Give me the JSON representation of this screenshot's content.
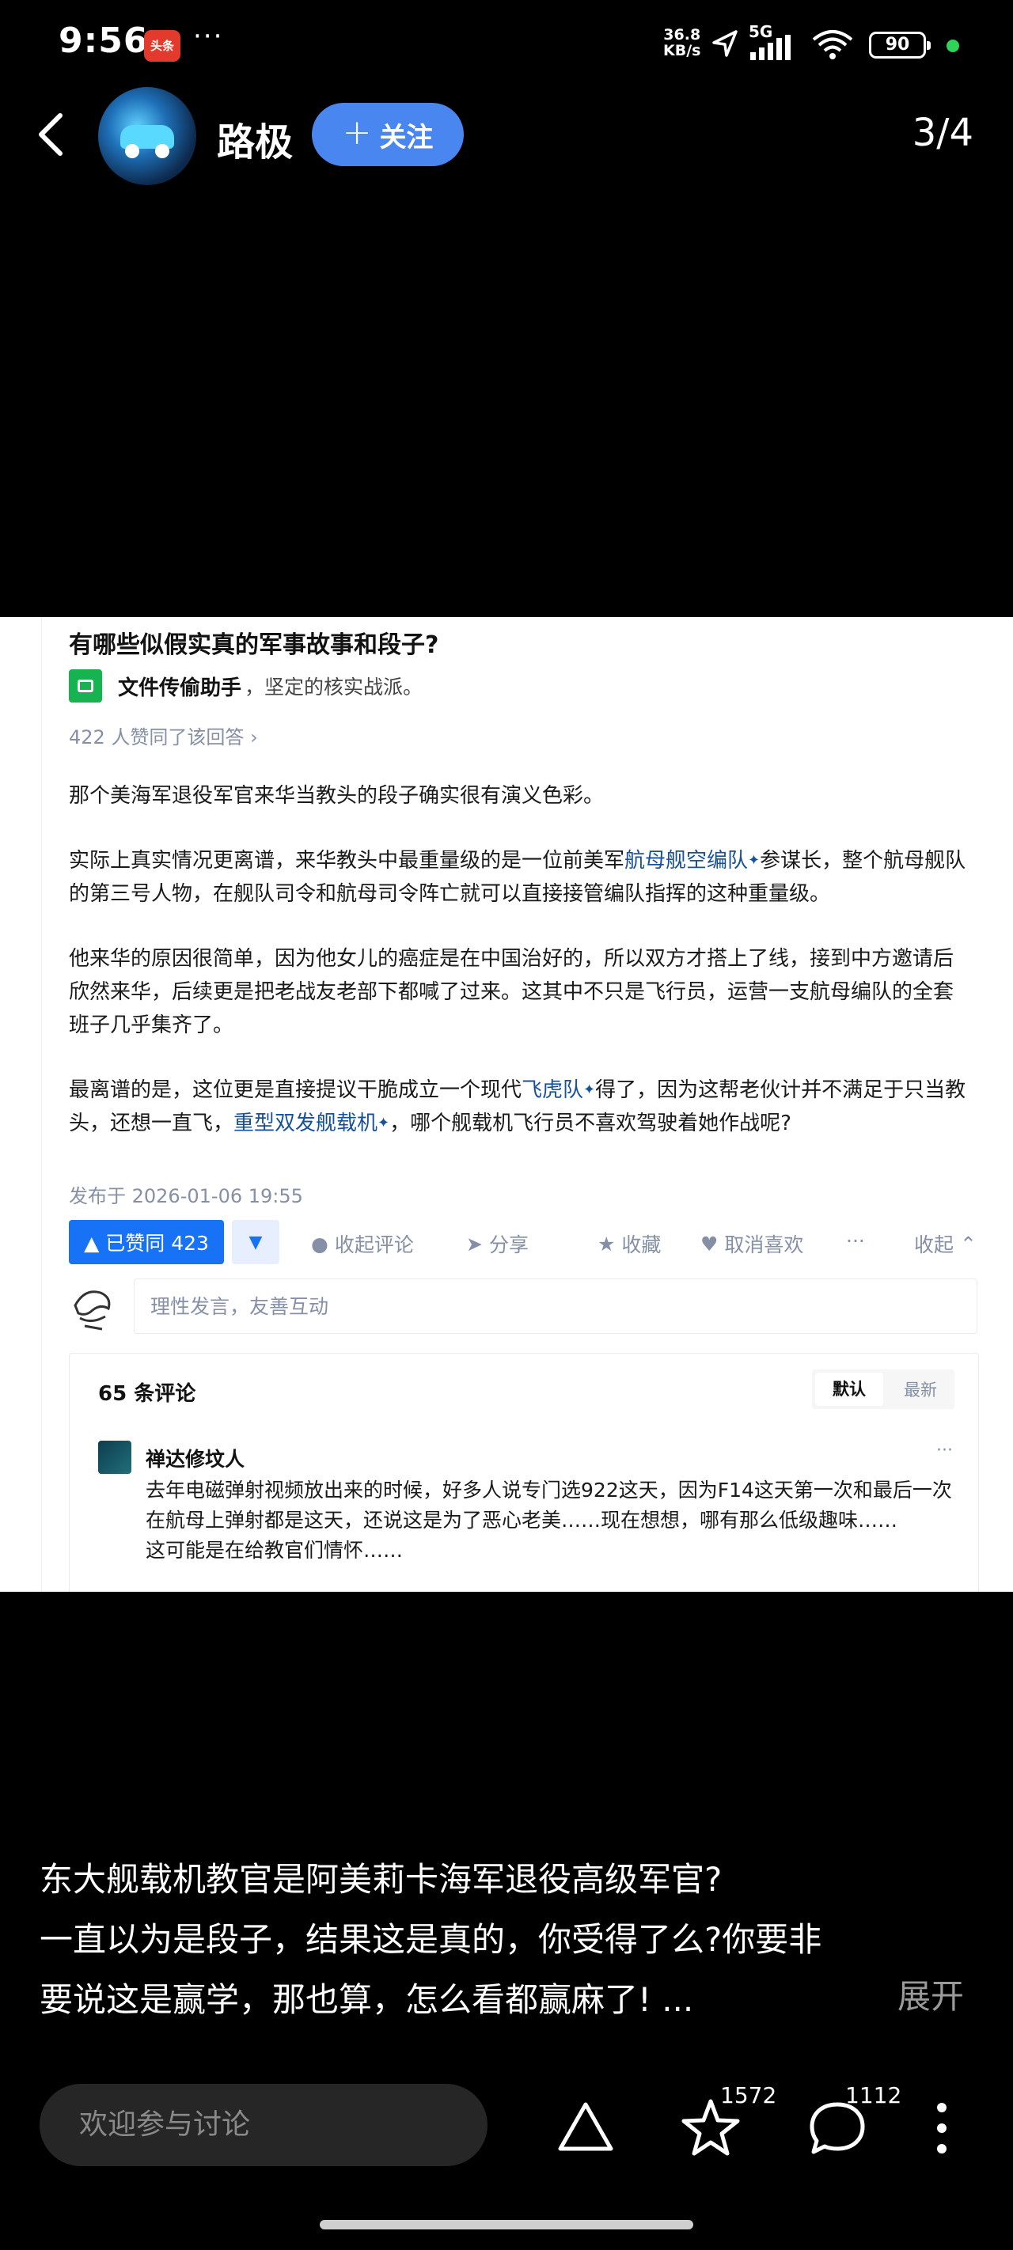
{
  "status_bar": {
    "time": "9:56",
    "app_badge": "头条",
    "dots": "···",
    "net_speed_value": "36.8",
    "net_speed_unit": "KB/s",
    "network": "5G",
    "battery": "90",
    "status_dot_color": "#2fd35a"
  },
  "header": {
    "author": "路极",
    "follow_label": "关注",
    "page_indicator": "3/4",
    "follow_color": "#4a86f0"
  },
  "screenshot": {
    "question_title": "有哪些似假实真的军事故事和段子?",
    "answer_author": "文件传偷助手",
    "answer_author_bio": "，坚定的核实战派。",
    "upvote_summary": "422 人赞同了该回答 ›",
    "paragraphs": {
      "p1": "那个美海军退役军官来华当教头的段子确实很有演义色彩。",
      "p2_a": "实际上真实情况更离谱，来华教头中最重量级的是一位前美军",
      "p2_link": "航母舰空编队",
      "p2_b": "参谋长，整个航母舰队的第三号人物，在舰队司令和航母司令阵亡就可以直接接管编队指挥的这种重量级。",
      "p3": "他来华的原因很简单，因为他女儿的癌症是在中国治好的，所以双方才搭上了线，接到中方邀请后欣然来华，后续更是把老战友老部下都喊了过来。这其中不只是飞行员，运营一支航母编队的全套班子几乎集齐了。",
      "p4_a": "最离谱的是，这位更是直接提议干脆成立一个现代",
      "p4_link1": "飞虎队",
      "p4_b": "得了，因为这帮老伙计并不满足于只当教头，还想一直飞，",
      "p4_link2": "重型双发舰载机",
      "p4_c": "，哪个舰载机飞行员不喜欢驾驶着她作战呢?"
    },
    "spark": "✦",
    "publish_time": "发布于 2026-01-06 19:55",
    "actions": {
      "upvote": "▲ 已赞同 423",
      "downvote": "▼",
      "collapse_comments": "收起评论",
      "share": "分享",
      "favorite": "收藏",
      "unlike": "取消喜欢",
      "more": "···",
      "collapse": "收起"
    },
    "comment_placeholder": "理性发言，友善互动",
    "comments_count": "65 条评论",
    "sort_default": "默认",
    "sort_latest": "最新",
    "comment": {
      "name": "禅达修坟人",
      "more": "···",
      "line1": "去年电磁弹射视频放出来的时候，好多人说专门选922这天，因为F14这天第一次和最后一次在航母上弹射都是这天，还说这是为了恶心老美……现在想想，哪有那么低级趣味……",
      "line2": "这可能是在给教官们情怀……"
    }
  },
  "caption": {
    "line1": "东大舰载机教官是阿美莉卡海军退役高级军官?",
    "line2": "一直以为是段子，结果这是真的，你受得了么?你要非要说这是赢学，那也算，怎么看都赢麻了! ...",
    "expand": "展开"
  },
  "bottom_bar": {
    "comment_placeholder": "欢迎参与讨论",
    "favorite_count": "1572",
    "comment_count": "1112"
  }
}
